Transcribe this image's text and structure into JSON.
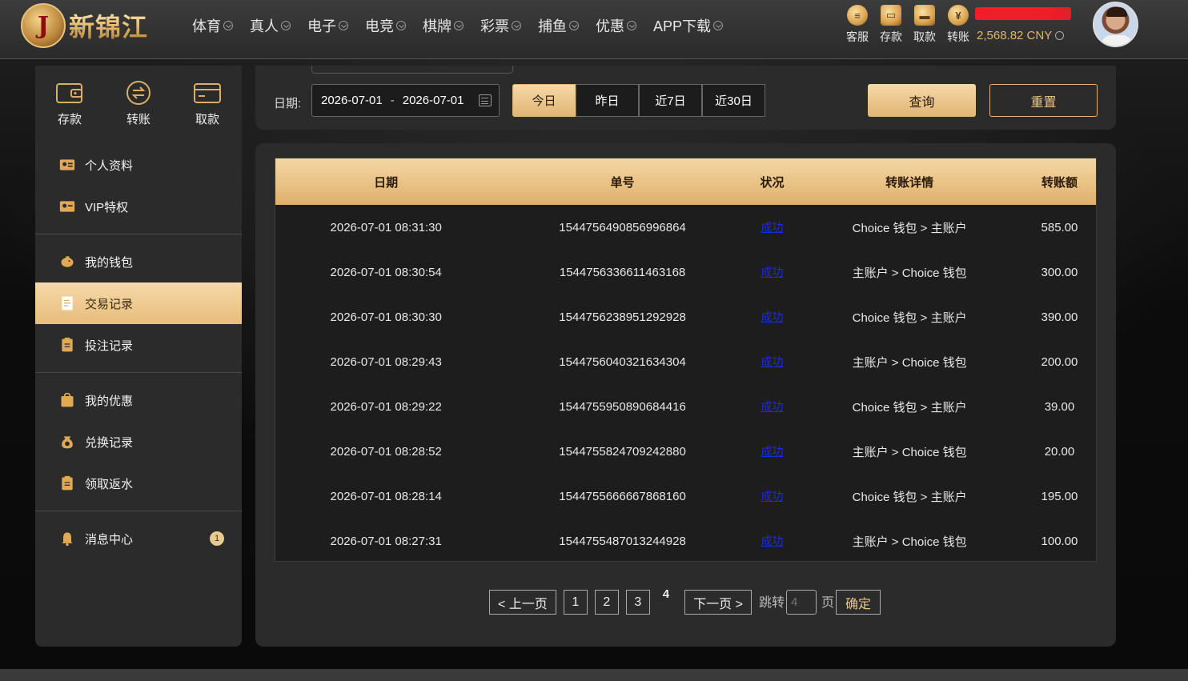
{
  "brand": {
    "badge": "J",
    "name": "新锦江"
  },
  "nav": [
    "体育",
    "真人",
    "电子",
    "电竞",
    "棋牌",
    "彩票",
    "捕鱼",
    "优惠",
    "APP下载"
  ],
  "quick_actions": [
    {
      "label": "客服",
      "icon": "chat-icon"
    },
    {
      "label": "存款",
      "icon": "wallet-icon"
    },
    {
      "label": "取款",
      "icon": "briefcase-icon"
    },
    {
      "label": "转账",
      "icon": "transfer-icon"
    }
  ],
  "account": {
    "balance": "2,568.82 CNY"
  },
  "sidebar": {
    "top_actions": [
      {
        "label": "存款"
      },
      {
        "label": "转账"
      },
      {
        "label": "取款"
      }
    ],
    "groups": [
      [
        {
          "label": "个人资料",
          "icon": "profile-card-icon"
        },
        {
          "label": "VIP特权",
          "icon": "vip-card-icon"
        }
      ],
      [
        {
          "label": "我的钱包",
          "icon": "piggy-bank-icon"
        },
        {
          "label": "交易记录",
          "icon": "document-icon",
          "active": true
        },
        {
          "label": "投注记录",
          "icon": "clipboard-icon"
        }
      ],
      [
        {
          "label": "我的优惠",
          "icon": "gift-bag-icon"
        },
        {
          "label": "兑换记录",
          "icon": "money-bag-icon"
        },
        {
          "label": "领取返水",
          "icon": "clipboard-icon"
        }
      ],
      [
        {
          "label": "消息中心",
          "icon": "bell-icon",
          "badge": "1"
        }
      ]
    ]
  },
  "filter": {
    "date_label": "日期:",
    "start_date": "2026-07-01",
    "separator": "-",
    "end_date": "2026-07-01",
    "ranges": [
      "今日",
      "昨日",
      "近7日",
      "近30日"
    ],
    "active_range": 0,
    "query_label": "查询",
    "reset_label": "重置"
  },
  "table": {
    "columns": [
      "日期",
      "单号",
      "状况",
      "转账详情",
      "转账额"
    ],
    "rows": [
      [
        "2026-07-01 08:31:30",
        "1544756490856996864",
        "成功",
        "Choice 钱包 > 主账户",
        "585.00"
      ],
      [
        "2026-07-01 08:30:54",
        "1544756336611463168",
        "成功",
        "主账户 > Choice 钱包",
        "300.00"
      ],
      [
        "2026-07-01 08:30:30",
        "1544756238951292928",
        "成功",
        "Choice 钱包 > 主账户",
        "390.00"
      ],
      [
        "2026-07-01 08:29:43",
        "1544756040321634304",
        "成功",
        "主账户 > Choice 钱包",
        "200.00"
      ],
      [
        "2026-07-01 08:29:22",
        "1544755950890684416",
        "成功",
        "Choice 钱包 > 主账户",
        "39.00"
      ],
      [
        "2026-07-01 08:28:52",
        "1544755824709242880",
        "成功",
        "主账户 > Choice 钱包",
        "20.00"
      ],
      [
        "2026-07-01 08:28:14",
        "1544755666667868160",
        "成功",
        "Choice 钱包 > 主账户",
        "195.00"
      ],
      [
        "2026-07-01 08:27:31",
        "1544755487013244928",
        "成功",
        "主账户 > Choice 钱包",
        "100.00"
      ]
    ]
  },
  "pagination": {
    "prev_label": "< 上一页",
    "pages": [
      "1",
      "2",
      "3"
    ],
    "current": "4",
    "next_label": "下一页 >",
    "jump_label": "跳转",
    "jump_value": "4",
    "page_suffix": "页",
    "confirm_label": "确定"
  },
  "colors": {
    "gold": "#e1b574",
    "gold_light": "#f6d9a8",
    "panel": "#2b2b2b",
    "status_link": "#1d2ed8"
  }
}
